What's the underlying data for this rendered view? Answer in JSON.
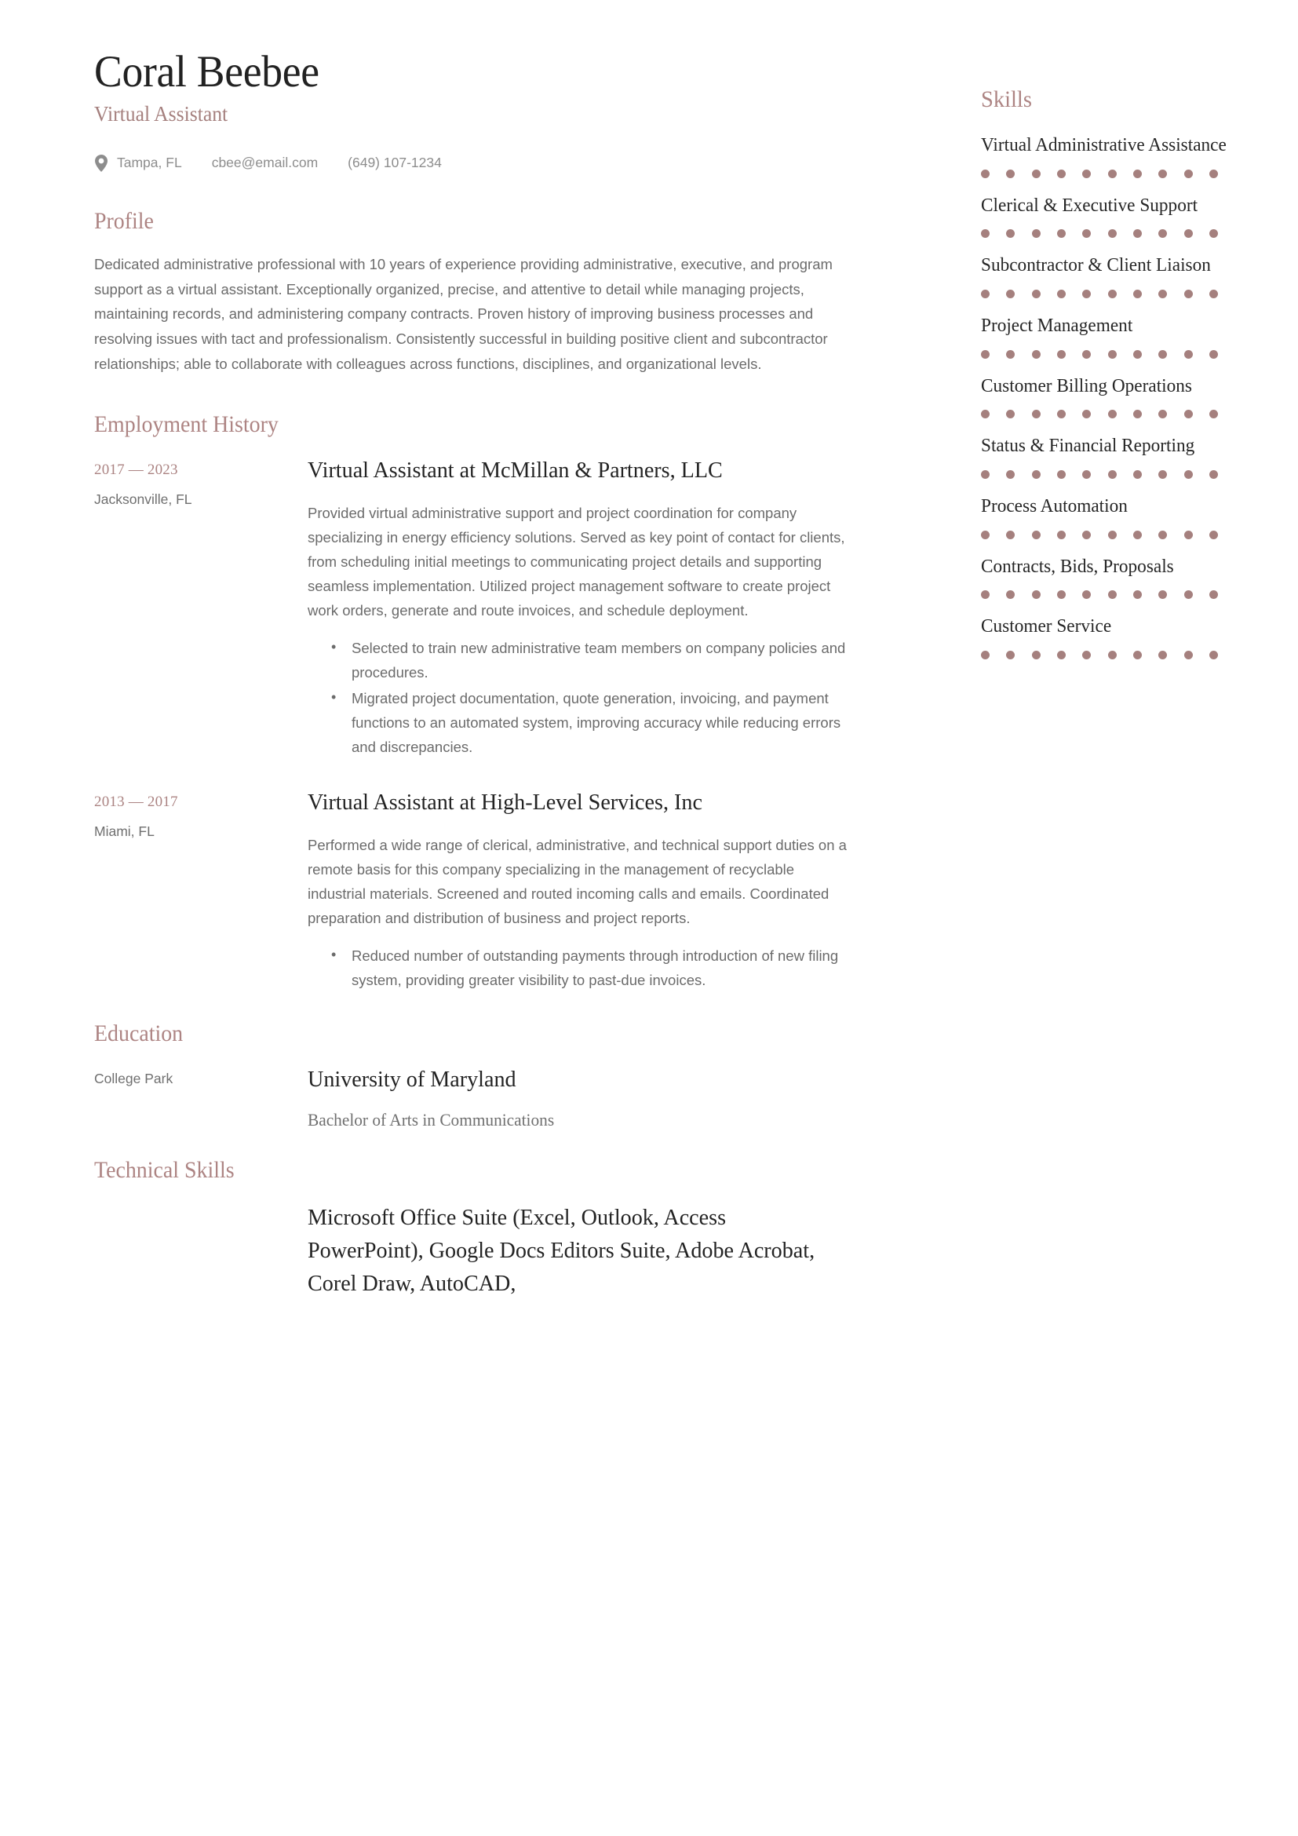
{
  "accent_color": "#a5807e",
  "heading_color": "#ad8483",
  "body_color": "#6b6b6b",
  "header": {
    "name": "Coral Beebee",
    "job_title": "Virtual Assistant",
    "location_icon": "location-pin-icon",
    "location": "Tampa, FL",
    "email": "cbee@email.com",
    "phone": "(649) 107-1234"
  },
  "profile": {
    "heading": "Profile",
    "text": "Dedicated administrative professional with 10 years of experience providing administrative, executive, and program support as a virtual assistant. Exceptionally organized, precise, and attentive to detail while managing projects, maintaining records, and administering company contracts. Proven history of improving business processes and resolving issues with tact and professionalism. Consistently successful in building positive client and subcontractor relationships; able to collaborate with colleagues across functions, disciplines, and organizational levels."
  },
  "employment": {
    "heading": "Employment History",
    "entries": [
      {
        "dates": "2017 — 2023",
        "place": "Jacksonville, FL",
        "title": "Virtual Assistant at McMillan & Partners, LLC",
        "body": "Provided virtual administrative support and project coordination for company specializing in energy efficiency solutions. Served as key point of contact for clients, from scheduling initial meetings to communicating project details and supporting seamless implementation. Utilized project management software to create project work orders, generate and route invoices, and schedule deployment.",
        "bullets": [
          "Selected to train new administrative team members on company policies and procedures.",
          "Migrated project documentation, quote generation, invoicing, and payment functions to an automated system, improving accuracy while reducing errors and discrepancies."
        ]
      },
      {
        "dates": "2013 — 2017",
        "place": "Miami, FL",
        "title": "Virtual Assistant at High-Level Services, Inc",
        "body": "Performed a wide range of clerical, administrative, and technical support duties on a remote basis for this company specializing in the management of recyclable industrial materials. Screened and routed incoming calls and emails. Coordinated preparation and distribution of business and project reports.",
        "bullets": [
          "Reduced number of outstanding payments through introduction of new filing system, providing greater visibility to past-due invoices."
        ]
      }
    ]
  },
  "education": {
    "heading": "Education",
    "entries": [
      {
        "place": "College Park",
        "school": "University of Maryland",
        "degree": "Bachelor of Arts in Communications"
      }
    ]
  },
  "technical_skills": {
    "heading": "Technical Skills",
    "text": "Microsoft Office Suite (Excel, Outlook, Access PowerPoint), Google Docs Editors Suite, Adobe Acrobat, Corel Draw, AutoCAD,"
  },
  "skills": {
    "heading": "Skills",
    "max_rating": 10,
    "items": [
      {
        "name": "Virtual Administrative Assistance",
        "rating": 10
      },
      {
        "name": "Clerical & Executive Support",
        "rating": 10
      },
      {
        "name": "Subcontractor & Client Liaison",
        "rating": 10
      },
      {
        "name": "Project Management",
        "rating": 10
      },
      {
        "name": "Customer Billing Operations",
        "rating": 10
      },
      {
        "name": "Status & Financial Reporting",
        "rating": 10
      },
      {
        "name": "Process Automation",
        "rating": 10
      },
      {
        "name": "Contracts, Bids, Proposals",
        "rating": 10
      },
      {
        "name": "Customer Service",
        "rating": 10
      }
    ]
  }
}
